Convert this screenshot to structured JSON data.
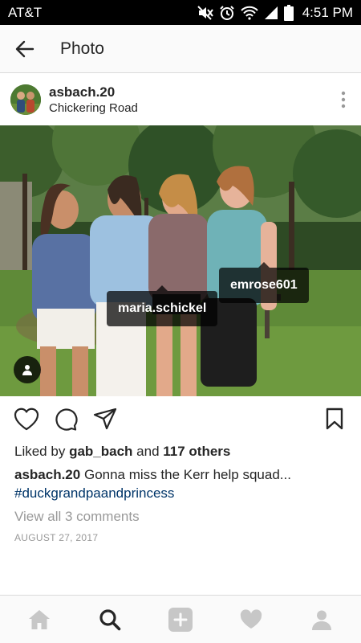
{
  "status_bar": {
    "carrier": "AT&T",
    "time": "4:51 PM",
    "icons": [
      "mute-icon",
      "alarm-icon",
      "wifi-icon",
      "signal-icon",
      "battery-icon"
    ]
  },
  "header": {
    "title": "Photo",
    "back_icon": "arrow-left-icon"
  },
  "post": {
    "username": "asbach.20",
    "location": "Chickering Road",
    "more_icon": "vertical-dots-icon",
    "tags": [
      "maria.schickel",
      "emrose601"
    ],
    "liked_by_prefix": "Liked by",
    "liked_by_user": "gab_bach",
    "liked_by_and": "and",
    "liked_by_others": "117 others",
    "caption_user": "asbach.20",
    "caption_text": "Gonna miss the Kerr help squad...",
    "hashtag": "#duckgrandpaandprincess",
    "view_comments": "View all 3 comments",
    "date": "AUGUST 27, 2017"
  },
  "actions": {
    "icons": [
      "heart-icon",
      "comment-icon",
      "share-icon",
      "bookmark-icon"
    ]
  },
  "bottom_nav": {
    "items": [
      "home-icon",
      "search-icon",
      "add-icon",
      "activity-heart-icon",
      "profile-icon"
    ],
    "active": "search-icon"
  },
  "colors": {
    "hashtag": "#003569",
    "muted_text": "#999999",
    "text": "#262626",
    "nav_inactive": "#c7c7c7"
  }
}
